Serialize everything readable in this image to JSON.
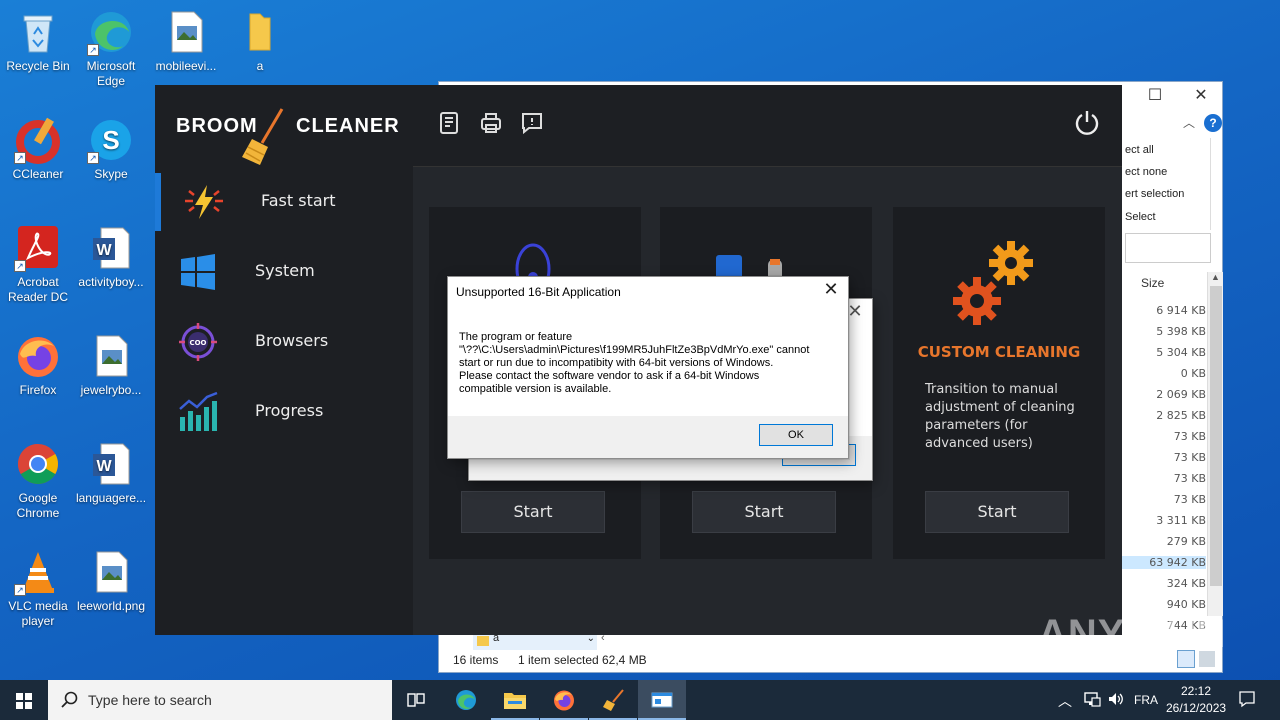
{
  "desktop": {
    "icons": [
      {
        "label": "Recycle Bin"
      },
      {
        "label": "Microsoft Edge"
      },
      {
        "label": "mobileevi..."
      },
      {
        "label": "a"
      },
      {
        "label": "CCleaner"
      },
      {
        "label": "Skype"
      },
      {
        "label": "Acrobat Reader DC"
      },
      {
        "label": "activityboy..."
      },
      {
        "label": "Firefox"
      },
      {
        "label": "jewelrybo..."
      },
      {
        "label": "Google Chrome"
      },
      {
        "label": "languagere..."
      },
      {
        "label": "VLC media player"
      },
      {
        "label": "leeworld.png"
      }
    ]
  },
  "explorer": {
    "ribbon_items": [
      "ect all",
      "ect none",
      "ert selection",
      "Select"
    ],
    "size_header": "Size",
    "sizes": [
      "6 914 KB",
      "5 398 KB",
      "5 304 KB",
      "0 KB",
      "2 069 KB",
      "2 825 KB",
      "73 KB",
      "73 KB",
      "73 KB",
      "73 KB",
      "3 311 KB",
      "279 KB",
      "63 942 KB",
      "324 KB",
      "940 KB",
      "744 KB"
    ],
    "selected_size_index": 12,
    "nav_folder": "a",
    "status_items": "16 items",
    "status_selected": "1 item selected",
    "status_size": "62,4 MB"
  },
  "broom": {
    "logo_left": "BROOM",
    "logo_right": "CLEANER",
    "nav": [
      {
        "label": "Fast start"
      },
      {
        "label": "System"
      },
      {
        "label": "Browsers"
      },
      {
        "label": "Progress"
      }
    ],
    "cards": [
      {
        "start_label": "Start"
      },
      {
        "start_label": "Start"
      },
      {
        "title": "CUSTOM CLEANING",
        "description": "Transition to manual adjustment of cleaning parameters (for advanced users)",
        "start_label": "Start"
      }
    ],
    "accent_color": "#e8762c"
  },
  "dialog_back": {
    "ok_label": "OK"
  },
  "dialog": {
    "title": "Unsupported 16-Bit Application",
    "message_line1": "The program or feature",
    "message_line2": "\"\\??\\C:\\Users\\admin\\Pictures\\f199MR5JuhFltZe3BpVdMrYo.exe\" cannot",
    "message_line3": "start or run due to incompatibity with 64-bit versions of Windows.",
    "message_line4": "Please contact the software vendor to ask if a 64-bit Windows",
    "message_line5": "compatible version is available.",
    "ok_label": "OK"
  },
  "taskbar": {
    "search_placeholder": "Type here to search",
    "language": "FRA",
    "time": "22:12",
    "date": "26/12/2023"
  },
  "watermark": "ANY RUN"
}
